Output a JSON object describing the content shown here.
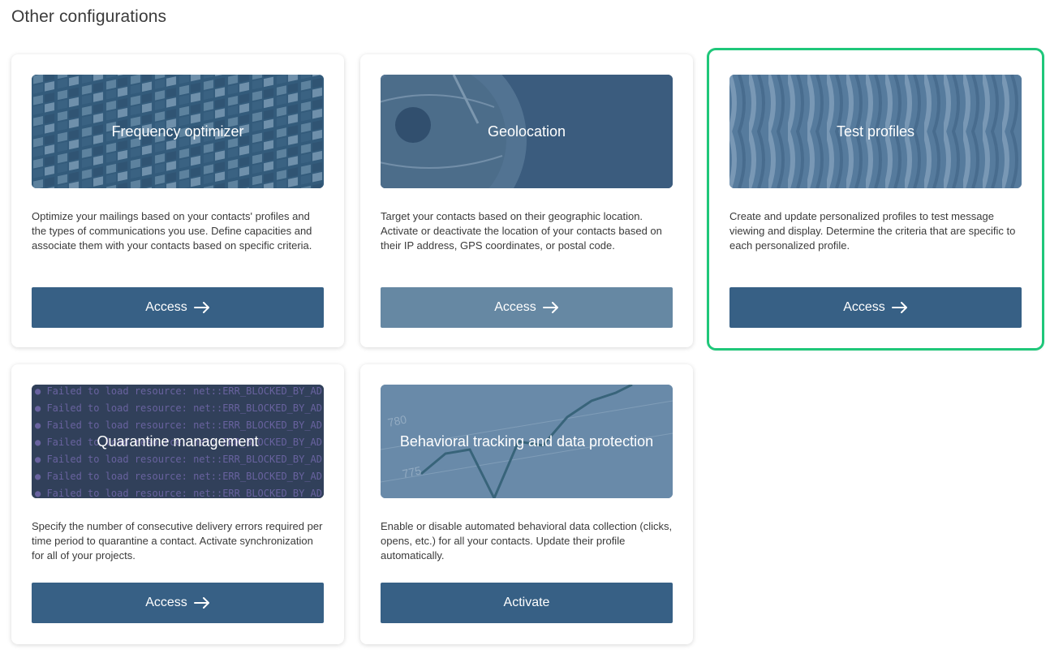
{
  "page": {
    "title": "Other configurations"
  },
  "colors": {
    "accent": "#376085",
    "highlight": "#1fc77a",
    "disabled_button": "#6688a3"
  },
  "cards": [
    {
      "title": "Frequency optimizer",
      "description": "Optimize your mailings based on your contacts' profiles and the types of communications you use. Define capacities and associate them with your contacts based on specific criteria.",
      "button_label": "Access",
      "button_icon": "arrow-right-icon"
    },
    {
      "title": "Geolocation",
      "description": "Target your contacts based on their geographic location. Activate or deactivate the location of your contacts based on their IP address, GPS coordinates, or postal code.",
      "button_label": "Access",
      "button_icon": "arrow-right-icon",
      "button_state": "disabled"
    },
    {
      "title": "Test profiles",
      "description": "Create and update personalized profiles to test message viewing and display. Determine the criteria that are specific to each personalized profile.",
      "button_label": "Access",
      "button_icon": "arrow-right-icon",
      "state": "highlighted"
    },
    {
      "title": "Quarantine management",
      "description": "Specify the number of consecutive delivery errors required per time period to quarantine a contact. Activate synchronization for all of your projects.",
      "button_label": "Access",
      "button_icon": "arrow-right-icon",
      "banner_text": "Failed to load resource: net::ERR_BLOCKED_BY_AD"
    },
    {
      "title": "Behavioral tracking and data protection",
      "description": "Enable or disable automated behavioral data collection (clicks, opens, etc.) for all your contacts. Update their profile automatically.",
      "button_label": "Activate",
      "banner_ticks": [
        "780",
        "775"
      ]
    }
  ]
}
